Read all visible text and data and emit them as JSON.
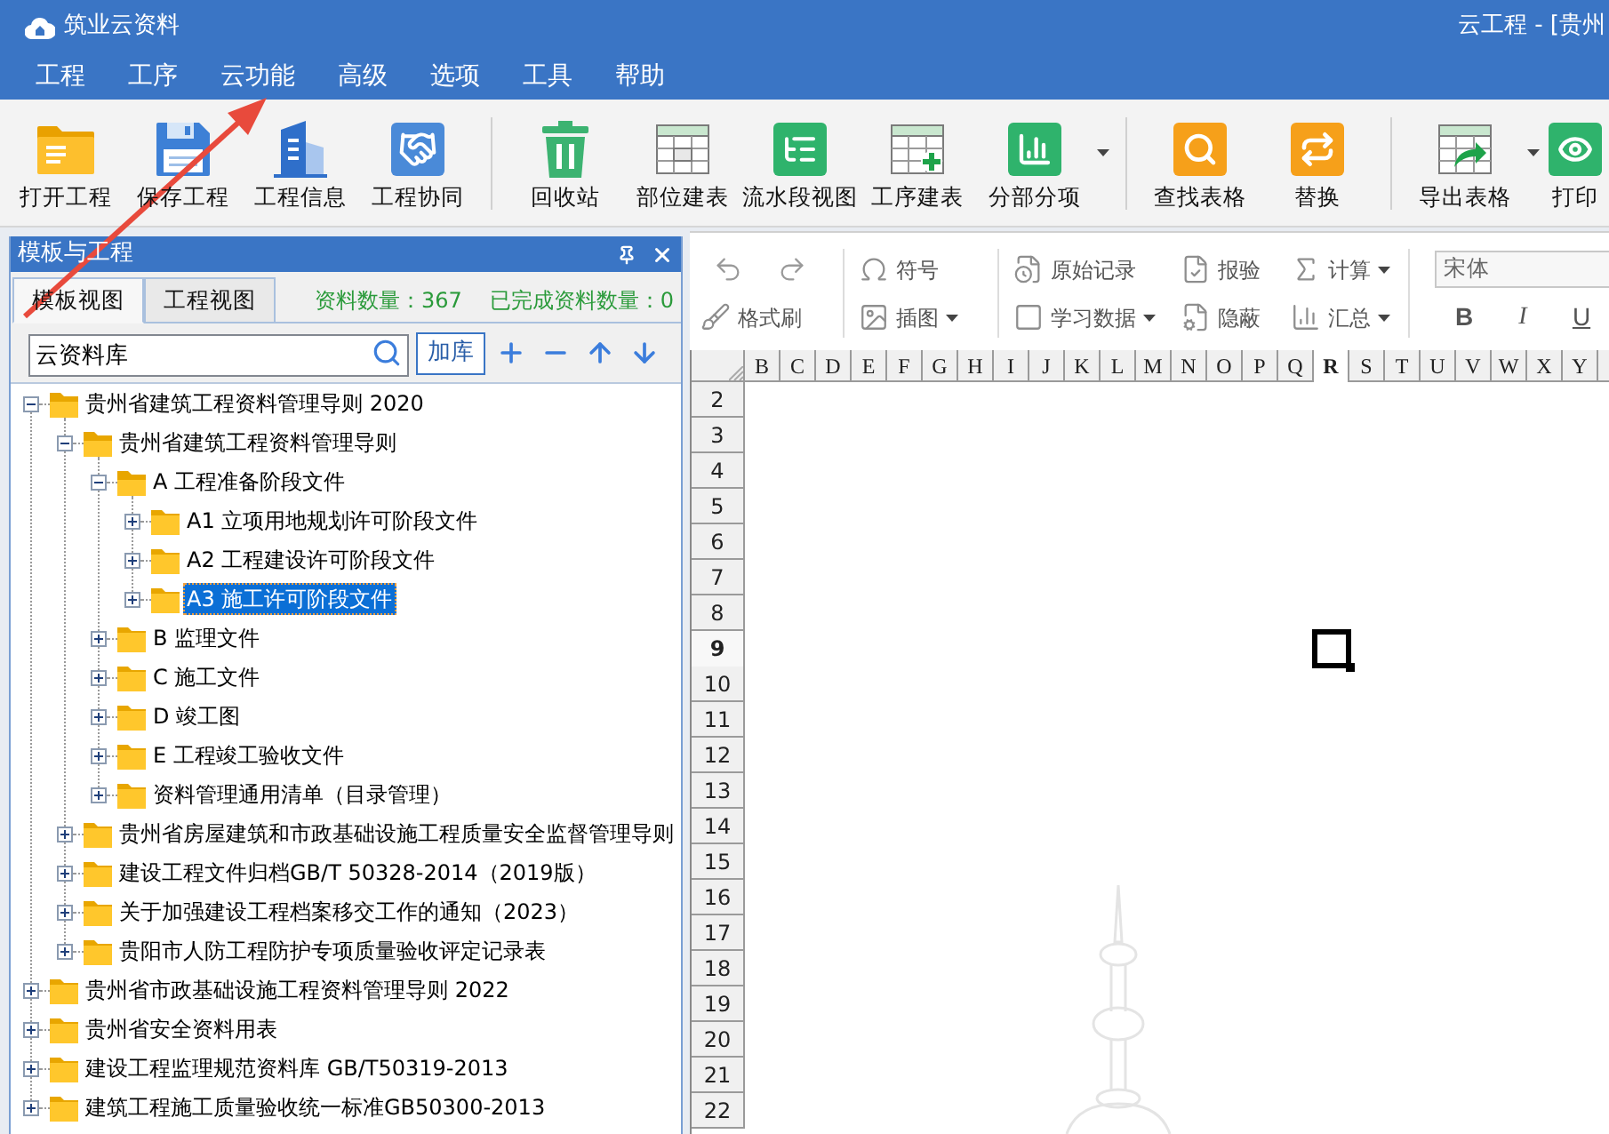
{
  "window": {
    "app_name": "筑业云资料",
    "title": "云工程 - [贵州"
  },
  "menu": [
    "工程",
    "工序",
    "云功能",
    "高级",
    "选项",
    "工具",
    "帮助"
  ],
  "toolbar": {
    "groups": [
      [
        {
          "label": "打开工程",
          "dropdown": false
        },
        {
          "label": "保存工程",
          "dropdown": false
        },
        {
          "label": "工程信息",
          "dropdown": false
        },
        {
          "label": "工程协同",
          "dropdown": false
        }
      ],
      [
        {
          "label": "回收站",
          "dropdown": false
        },
        {
          "label": "部位建表",
          "dropdown": false
        },
        {
          "label": "流水段视图",
          "dropdown": false
        },
        {
          "label": "工序建表",
          "dropdown": false
        },
        {
          "label": "分部分项",
          "dropdown": true
        }
      ],
      [
        {
          "label": "查找表格",
          "dropdown": false
        },
        {
          "label": "替换",
          "dropdown": false
        }
      ],
      [
        {
          "label": "导出表格",
          "dropdown": true
        },
        {
          "label": "打印",
          "dropdown": false
        }
      ]
    ]
  },
  "panel": {
    "title": "模板与工程",
    "tabs": [
      {
        "label": "模板视图",
        "selected": true
      },
      {
        "label": "工程视图",
        "selected": false
      }
    ],
    "stats": [
      "资料数量：367",
      "已完成资料数量：0"
    ],
    "search": {
      "value": "云资料库"
    },
    "add_button": "加库",
    "tree": [
      {
        "label": "贵州省建筑工程资料管理导则 2020",
        "expanded": true,
        "selected": false,
        "children": [
          {
            "label": "贵州省建筑工程资料管理导则",
            "expanded": true,
            "selected": false,
            "children": [
              {
                "label": "A 工程准备阶段文件",
                "expanded": true,
                "selected": false,
                "children": [
                  {
                    "label": "A1 立项用地规划许可阶段文件",
                    "expanded": false,
                    "selected": false
                  },
                  {
                    "label": "A2 工程建设许可阶段文件",
                    "expanded": false,
                    "selected": false
                  },
                  {
                    "label": "A3 施工许可阶段文件",
                    "expanded": false,
                    "selected": true
                  }
                ]
              },
              {
                "label": "B 监理文件",
                "expanded": false,
                "selected": false
              },
              {
                "label": "C 施工文件",
                "expanded": false,
                "selected": false
              },
              {
                "label": "D 竣工图",
                "expanded": false,
                "selected": false
              },
              {
                "label": "E 工程竣工验收文件",
                "expanded": false,
                "selected": false
              },
              {
                "label": "资料管理通用清单（目录管理）",
                "expanded": false,
                "selected": false
              }
            ]
          },
          {
            "label": "贵州省房屋建筑和市政基础设施工程质量安全监督管理导则",
            "expanded": false,
            "selected": false
          },
          {
            "label": "建设工程文件归档GB/T 50328-2014（2019版）",
            "expanded": false,
            "selected": false
          },
          {
            "label": "关于加强建设工程档案移交工作的通知（2023）",
            "expanded": false,
            "selected": false
          },
          {
            "label": "贵阳市人防工程防护专项质量验收评定记录表",
            "expanded": false,
            "selected": false
          }
        ]
      },
      {
        "label": "贵州省市政基础设施工程资料管理导则 2022",
        "expanded": false,
        "selected": false
      },
      {
        "label": "贵州省安全资料用表",
        "expanded": false,
        "selected": false
      },
      {
        "label": "建设工程监理规范资料库 GB/T50319-2013",
        "expanded": false,
        "selected": false
      },
      {
        "label": "建筑工程施工质量验收统一标准GB50300-2013",
        "expanded": false,
        "selected": false
      }
    ]
  },
  "edit_toolbar": {
    "groups": [
      {
        "top": [
          {
            "kind": "icon"
          },
          {
            "kind": "icon"
          }
        ],
        "bottom": [
          {
            "kind": "labeled",
            "label": "格式刷",
            "dropdown": false
          }
        ]
      },
      {
        "top": [
          {
            "kind": "labeled",
            "label": "符号",
            "dropdown": false
          }
        ],
        "bottom": [
          {
            "kind": "labeled",
            "label": "插图",
            "dropdown": true
          }
        ]
      },
      {
        "top": [
          {
            "kind": "labeled",
            "label": "原始记录",
            "dropdown": false
          },
          {
            "kind": "labeled",
            "label": "报验",
            "dropdown": false
          },
          {
            "kind": "labeled",
            "label": "计算",
            "dropdown": true
          }
        ],
        "bottom": [
          {
            "kind": "labeled",
            "label": "学习数据",
            "dropdown": true
          },
          {
            "kind": "labeled",
            "label": "隐蔽",
            "dropdown": false
          },
          {
            "kind": "labeled",
            "label": "汇总",
            "dropdown": true
          }
        ]
      }
    ],
    "font": {
      "value": "宋体"
    },
    "format_buttons": [
      "B",
      "I",
      "U"
    ]
  },
  "sheet": {
    "columns": [
      {
        "label": "B",
        "selected": false
      },
      {
        "label": "C",
        "selected": false
      },
      {
        "label": "D",
        "selected": false
      },
      {
        "label": "E",
        "selected": false
      },
      {
        "label": "F",
        "selected": false
      },
      {
        "label": "G",
        "selected": false
      },
      {
        "label": "H",
        "selected": false
      },
      {
        "label": "I",
        "selected": false
      },
      {
        "label": "J",
        "selected": false
      },
      {
        "label": "K",
        "selected": false
      },
      {
        "label": "L",
        "selected": false
      },
      {
        "label": "M",
        "selected": false
      },
      {
        "label": "N",
        "selected": false
      },
      {
        "label": "O",
        "selected": false
      },
      {
        "label": "P",
        "selected": false
      },
      {
        "label": "Q",
        "selected": false
      },
      {
        "label": "R",
        "selected": true
      },
      {
        "label": "S",
        "selected": false
      },
      {
        "label": "T",
        "selected": false
      },
      {
        "label": "U",
        "selected": false
      },
      {
        "label": "V",
        "selected": false
      },
      {
        "label": "W",
        "selected": false
      },
      {
        "label": "X",
        "selected": false
      },
      {
        "label": "Y",
        "selected": false
      }
    ],
    "rows": [
      {
        "label": "2",
        "selected": false
      },
      {
        "label": "3",
        "selected": false
      },
      {
        "label": "4",
        "selected": false
      },
      {
        "label": "5",
        "selected": false
      },
      {
        "label": "6",
        "selected": false
      },
      {
        "label": "7",
        "selected": false
      },
      {
        "label": "8",
        "selected": false
      },
      {
        "label": "9",
        "selected": true
      },
      {
        "label": "10",
        "selected": false
      },
      {
        "label": "11",
        "selected": false
      },
      {
        "label": "12",
        "selected": false
      },
      {
        "label": "13",
        "selected": false
      },
      {
        "label": "14",
        "selected": false
      },
      {
        "label": "15",
        "selected": false
      },
      {
        "label": "16",
        "selected": false
      },
      {
        "label": "17",
        "selected": false
      },
      {
        "label": "18",
        "selected": false
      },
      {
        "label": "19",
        "selected": false
      },
      {
        "label": "20",
        "selected": false
      },
      {
        "label": "21",
        "selected": false
      },
      {
        "label": "22",
        "selected": false
      }
    ]
  }
}
